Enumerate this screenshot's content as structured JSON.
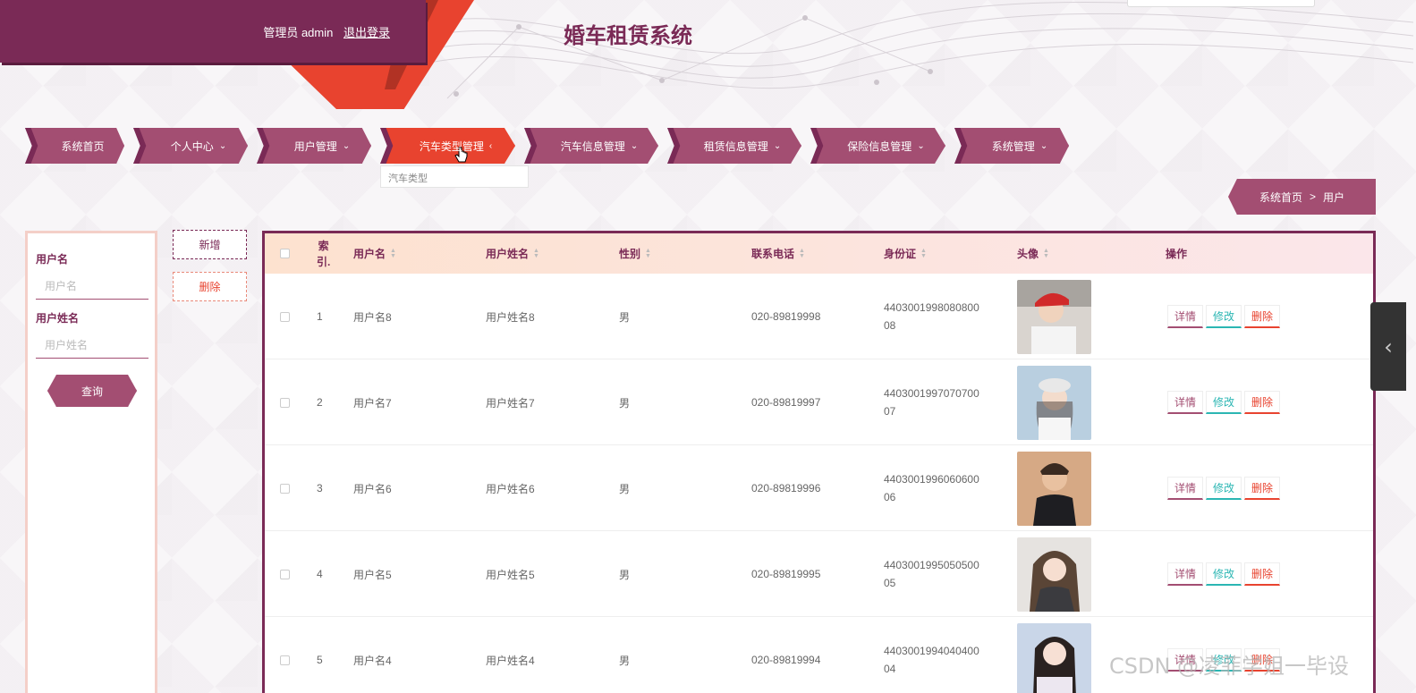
{
  "header": {
    "admin_label": "管理员 admin",
    "logout_label": "退出登录",
    "site_title": "婚车租赁系统"
  },
  "nav": [
    {
      "label": "系统首页",
      "chevron": ""
    },
    {
      "label": "个人中心",
      "chevron": "⌄"
    },
    {
      "label": "用户管理",
      "chevron": "⌄"
    },
    {
      "label": "汽车类型管理",
      "chevron": "‹"
    },
    {
      "label": "汽车信息管理",
      "chevron": "⌄"
    },
    {
      "label": "租赁信息管理",
      "chevron": "⌄"
    },
    {
      "label": "保险信息管理",
      "chevron": "⌄"
    },
    {
      "label": "系统管理",
      "chevron": "⌄"
    }
  ],
  "dropdown": {
    "item": "汽车类型"
  },
  "breadcrumb": {
    "home": "系统首页",
    "sep": ">",
    "current": "用户"
  },
  "search": {
    "username_label": "用户名",
    "username_placeholder": "用户名",
    "name_label": "用户姓名",
    "name_placeholder": "用户姓名",
    "query_label": "查询"
  },
  "actions": {
    "add": "新增",
    "delete": "删除"
  },
  "table": {
    "headers": {
      "index_top": "索",
      "index_bottom": "引.",
      "username": "用户名",
      "name": "用户姓名",
      "gender": "性别",
      "phone": "联系电话",
      "idcard": "身份证",
      "avatar": "头像",
      "ops": "操作"
    },
    "op_labels": {
      "detail": "详情",
      "edit": "修改",
      "remove": "删除"
    },
    "rows": [
      {
        "index": "1",
        "username": "用户名8",
        "name": "用户姓名8",
        "gender": "男",
        "phone": "020-89819998",
        "idcard_a": "4403001998080800",
        "idcard_b": "08"
      },
      {
        "index": "2",
        "username": "用户名7",
        "name": "用户姓名7",
        "gender": "男",
        "phone": "020-89819997",
        "idcard_a": "4403001997070700",
        "idcard_b": "07"
      },
      {
        "index": "3",
        "username": "用户名6",
        "name": "用户姓名6",
        "gender": "男",
        "phone": "020-89819996",
        "idcard_a": "4403001996060600",
        "idcard_b": "06"
      },
      {
        "index": "4",
        "username": "用户名5",
        "name": "用户姓名5",
        "gender": "男",
        "phone": "020-89819995",
        "idcard_a": "4403001995050500",
        "idcard_b": "05"
      },
      {
        "index": "5",
        "username": "用户名4",
        "name": "用户姓名4",
        "gender": "男",
        "phone": "020-89819994",
        "idcard_a": "4403001994040400",
        "idcard_b": "04"
      }
    ]
  },
  "watermark": "CSDN @凌菲学姐一毕设",
  "colors": {
    "primary": "#7a2a56",
    "accent": "#e8432f",
    "nav": "#a34e72",
    "teal": "#2bb6b3"
  }
}
